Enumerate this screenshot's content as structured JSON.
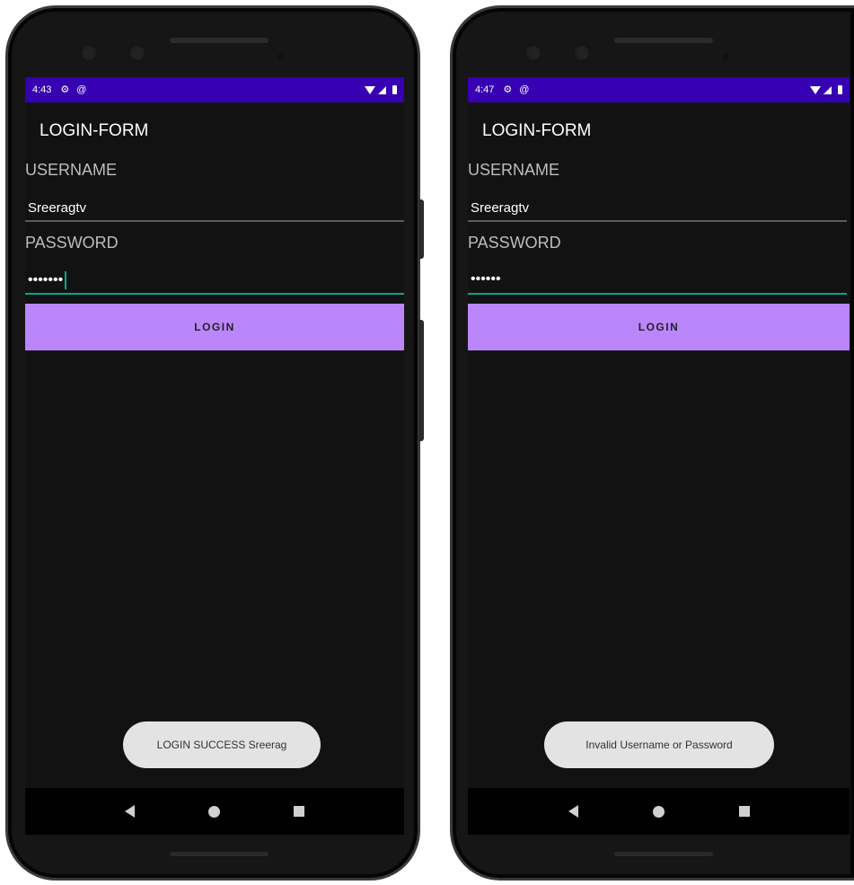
{
  "screens": [
    {
      "status": {
        "time": "4:43"
      },
      "app_title": "LOGIN-FORM",
      "username": {
        "label": "USERNAME",
        "value": "Sreeragtv"
      },
      "password": {
        "label": "PASSWORD",
        "value": "•••••••"
      },
      "login_label": "LOGIN",
      "toast": "LOGIN SUCCESS Sreerag"
    },
    {
      "status": {
        "time": "4:47"
      },
      "app_title": "LOGIN-FORM",
      "username": {
        "label": "USERNAME",
        "value": "Sreeragtv"
      },
      "password": {
        "label": "PASSWORD",
        "value": "••••••"
      },
      "login_label": "LOGIN",
      "toast": "Invalid Username or Password"
    }
  ],
  "icons": {
    "status": [
      "gear-icon",
      "at-sign-icon",
      "wifi-icon",
      "signal-icon",
      "battery-icon"
    ],
    "nav": [
      "back-icon",
      "home-icon",
      "recents-icon"
    ]
  },
  "colors": {
    "status_bar": "#3700b3",
    "button": "#bb86fc",
    "focus_underline": "#03a88b",
    "background": "#121212"
  }
}
